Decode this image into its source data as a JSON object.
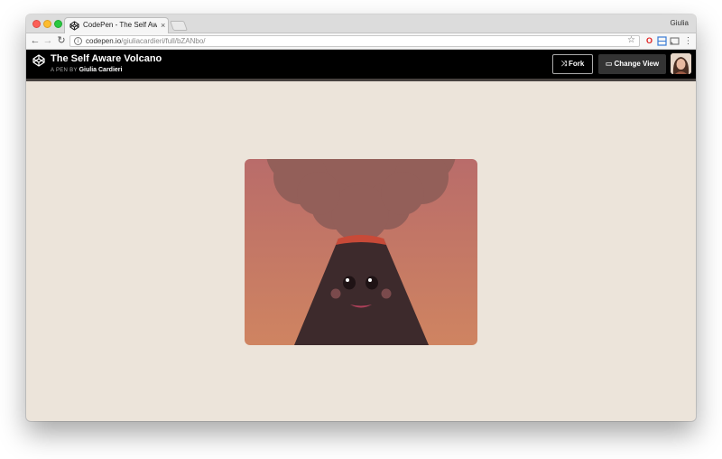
{
  "browser": {
    "tab_title": "CodePen - The Self Aware Volcano",
    "tab_close": "×",
    "profile_name": "Giulia",
    "url_host": "codepen.io",
    "url_path": "/giuliacardieri/full/bZANbo/"
  },
  "icons": {
    "back": "arrow-left-icon",
    "forward": "arrow-right-icon",
    "reload": "reload-icon",
    "info": "info-icon",
    "star": "star-icon",
    "opera": "opera-extension-icon",
    "tiles": "tiles-extension-icon",
    "cast": "cast-icon",
    "menu": "kebab-menu-icon"
  },
  "pen": {
    "title": "The Self Aware Volcano",
    "author_prefix": "A PEN BY",
    "author_name": "Giulia Cardieri",
    "fork_label": "Fork",
    "change_view_label": "Change View"
  },
  "colors": {
    "page_background": "#ece4da",
    "header_background": "#000000",
    "sky_top": "#b96c6a",
    "sky_bottom": "#cf8461",
    "smoke": "#935f59",
    "volcano": "#3d2a2c",
    "lava_rim": "#c84a38",
    "cheeks": "#7a4a4c",
    "mouth": "#b0405a"
  }
}
